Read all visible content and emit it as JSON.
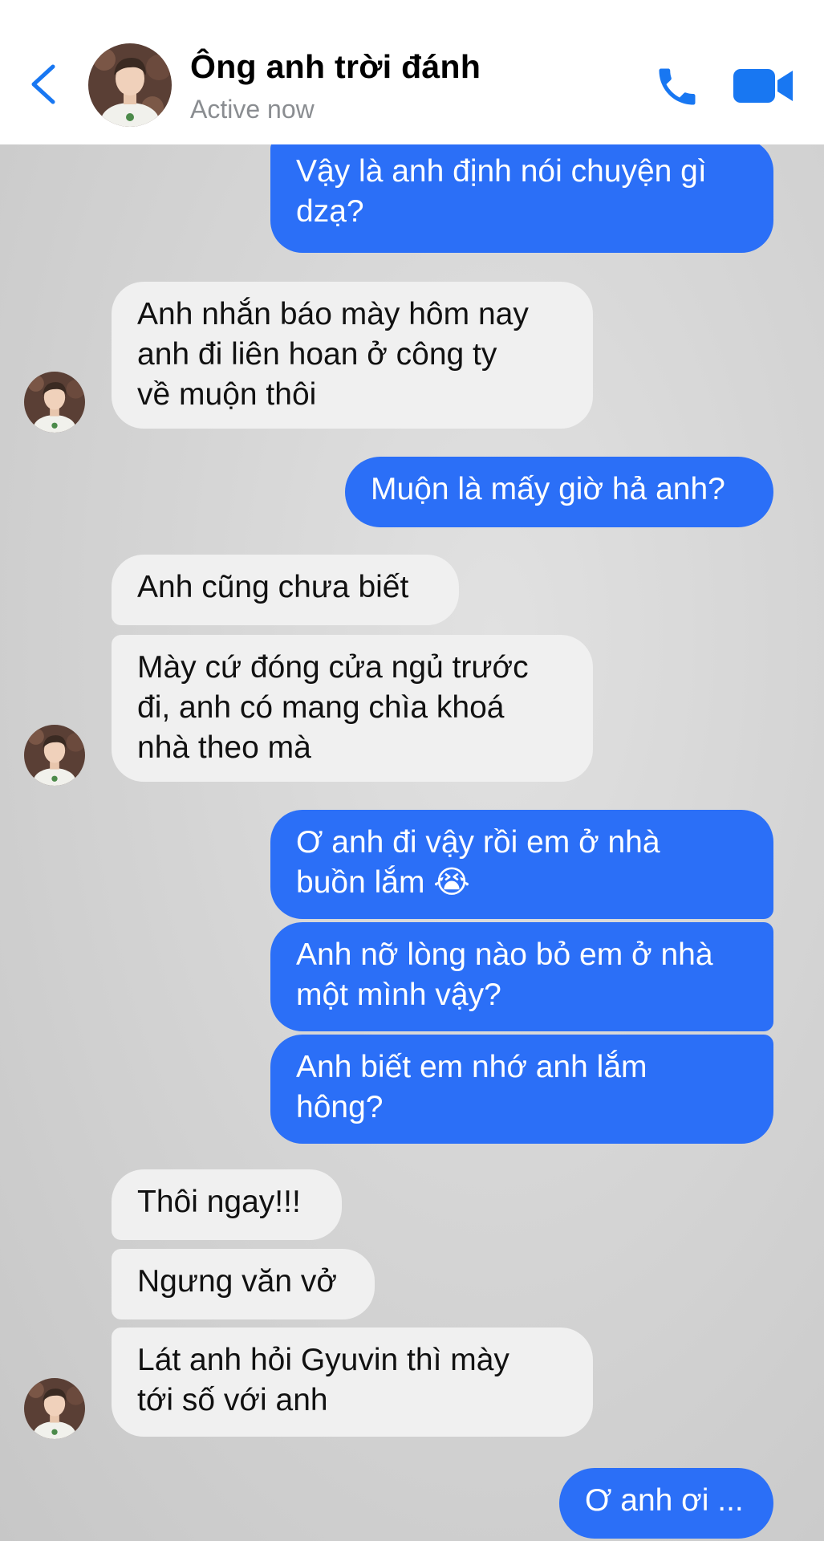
{
  "header": {
    "contact_name": "Ông anh trời đánh",
    "status": "Active now",
    "icons": {
      "back": "chevron-left-icon",
      "call": "phone-icon",
      "video": "video-camera-icon"
    },
    "accent_color": "#1877f2"
  },
  "messages": [
    {
      "from": "me",
      "text": "Vậy là anh định nói chuyện gì\ndzạ?"
    },
    {
      "from": "them",
      "text": "Anh nhắn báo mày hôm nay\nanh đi liên hoan ở công ty\nvề muộn thôi"
    },
    {
      "from": "me",
      "text": "Muộn là mấy giờ hả anh?"
    },
    {
      "from": "them",
      "text": "Anh cũng chưa biết"
    },
    {
      "from": "them",
      "text": "Mày cứ đóng cửa ngủ trước\nđi, anh có mang chìa khoá\nnhà theo mà"
    },
    {
      "from": "me",
      "text": "Ơ anh đi vậy rồi em ở nhà\nbuồn lắm 😭"
    },
    {
      "from": "me",
      "text": "Anh nỡ lòng nào bỏ em ở nhà\nmột mình vậy?"
    },
    {
      "from": "me",
      "text": "Anh biết em nhớ anh lắm\nhông?"
    },
    {
      "from": "them",
      "text": "Thôi ngay!!!"
    },
    {
      "from": "them",
      "text": "Ngưng văn vở"
    },
    {
      "from": "them",
      "text": "Lát anh hỏi Gyuvin thì mày\ntới số với anh"
    },
    {
      "from": "me",
      "text": "Ơ anh ơi ..."
    }
  ],
  "colors": {
    "outgoing_bubble": "#2b6ff7",
    "incoming_bubble": "#f0f0f0"
  }
}
